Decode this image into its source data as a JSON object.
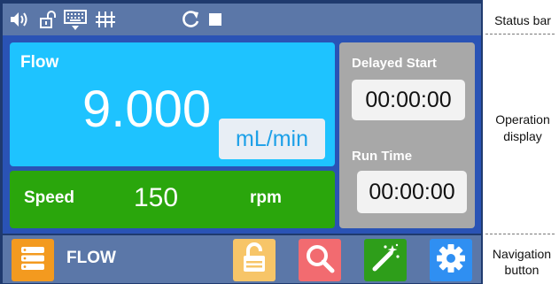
{
  "status_bar": {
    "icons": [
      "speaker-icon",
      "unlocked-padlock-icon",
      "keyboard-icon",
      "pump-rollers-icon",
      "refresh-icon",
      "stop-icon"
    ]
  },
  "flow": {
    "title": "Flow",
    "value": "9.000",
    "unit": "mL/min"
  },
  "speed": {
    "label": "Speed",
    "value": "150",
    "unit": "rpm"
  },
  "delayed_start": {
    "label": "Delayed Start",
    "value": "00:00:00"
  },
  "run_time": {
    "label": "Run Time",
    "value": "00:00:00"
  },
  "navigation": {
    "mode_label": "FLOW",
    "buttons": [
      {
        "icon": "menu-list-icon",
        "color": "#f39a1f"
      },
      {
        "icon": "unlock-icon",
        "color": "#f7c568"
      },
      {
        "icon": "search-icon",
        "color": "#f26b70"
      },
      {
        "icon": "magic-wand-icon",
        "color": "#2e9e1a"
      },
      {
        "icon": "settings-gear-icon",
        "color": "#2f8ff2"
      }
    ]
  },
  "annotations": {
    "status_bar": "Status bar",
    "operation_line1": "Operation",
    "operation_line2": "display",
    "navigation_line1": "Navigation",
    "navigation_line2": "button"
  },
  "colors": {
    "background": "#1f3a6e",
    "bar": "#5b77a8",
    "flow_card": "#1ec3ff",
    "speed_card": "#2aa60c",
    "side_panel": "#a8a8a8"
  }
}
